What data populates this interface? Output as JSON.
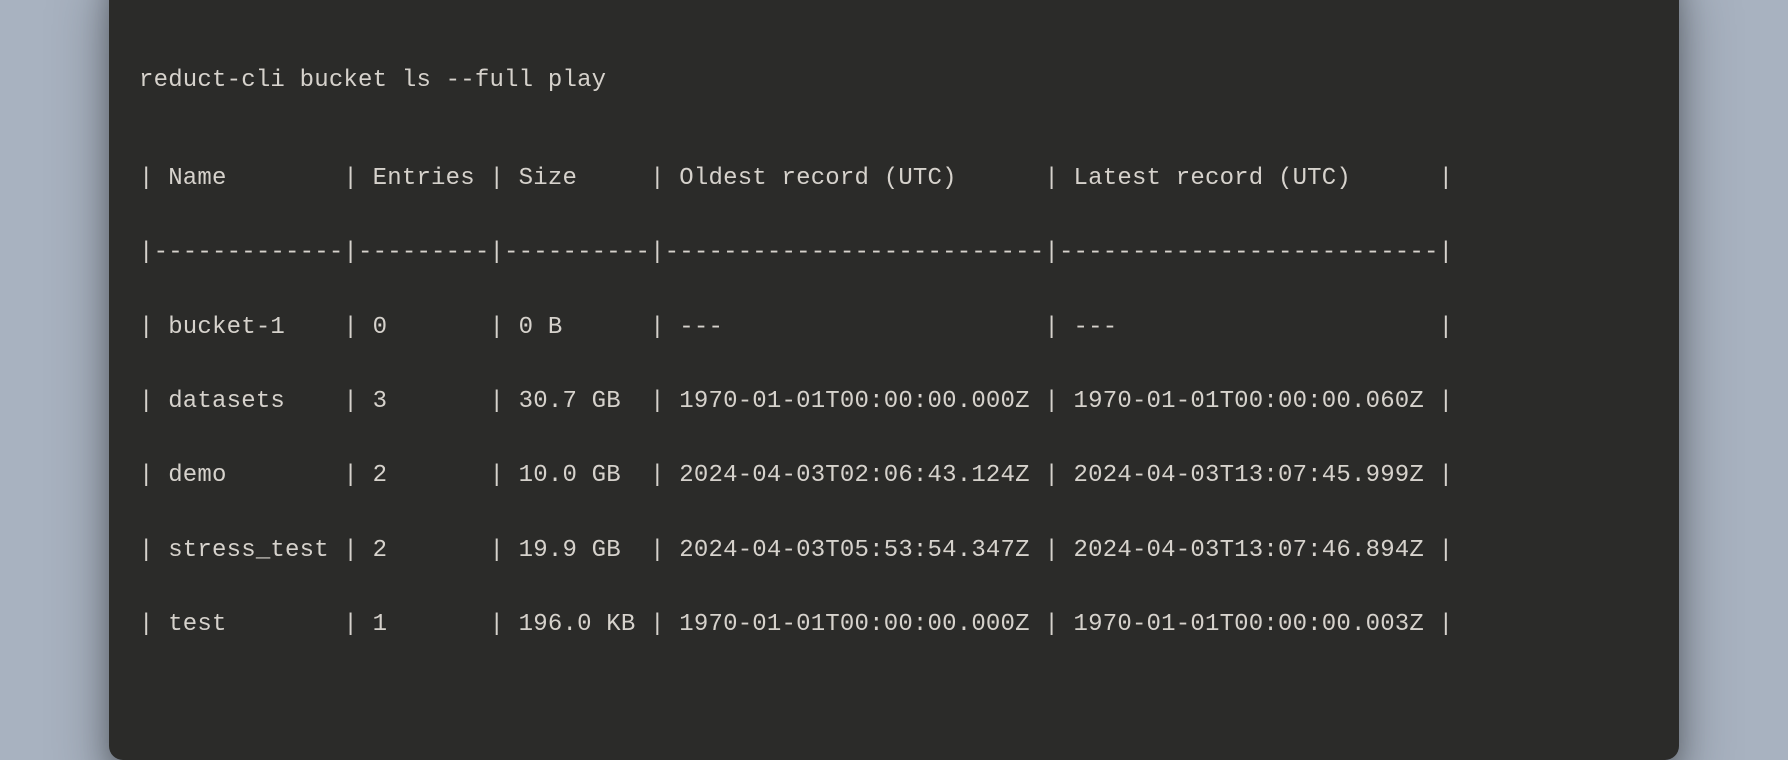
{
  "command": "reduct-cli bucket ls --full play",
  "columns": [
    "Name",
    "Entries",
    "Size",
    "Oldest record (UTC)",
    "Latest record (UTC)"
  ],
  "widths": [
    13,
    9,
    10,
    26,
    26
  ],
  "rows": [
    {
      "name": "bucket-1",
      "entries": "0",
      "size": "0 B",
      "oldest": "---",
      "latest": "---"
    },
    {
      "name": "datasets",
      "entries": "3",
      "size": "30.7 GB",
      "oldest": "1970-01-01T00:00:00.000Z",
      "latest": "1970-01-01T00:00:00.060Z"
    },
    {
      "name": "demo",
      "entries": "2",
      "size": "10.0 GB",
      "oldest": "2024-04-03T02:06:43.124Z",
      "latest": "2024-04-03T13:07:45.999Z"
    },
    {
      "name": "stress_test",
      "entries": "2",
      "size": "19.9 GB",
      "oldest": "2024-04-03T05:53:54.347Z",
      "latest": "2024-04-03T13:07:46.894Z"
    },
    {
      "name": "test",
      "entries": "1",
      "size": "196.0 KB",
      "oldest": "1970-01-01T00:00:00.000Z",
      "latest": "1970-01-01T00:00:00.003Z"
    }
  ],
  "_derived": {}
}
